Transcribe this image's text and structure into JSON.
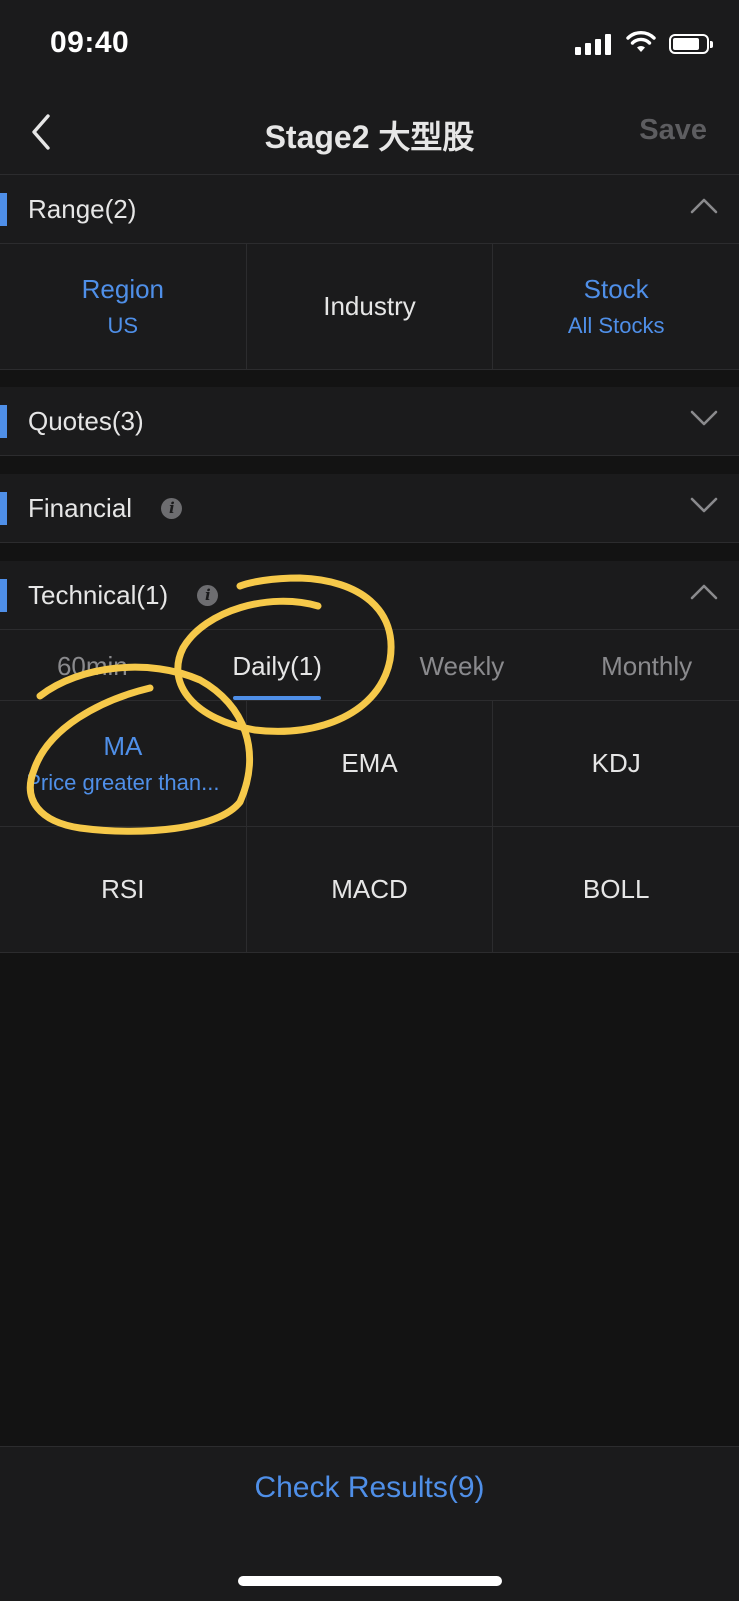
{
  "status_bar": {
    "time": "09:40"
  },
  "nav": {
    "title": "Stage2 大型股",
    "save_label": "Save"
  },
  "range": {
    "label": "Range(2)",
    "cells": [
      {
        "title": "Region",
        "value": "US"
      },
      {
        "title": "Industry",
        "value": ""
      },
      {
        "title": "Stock",
        "value": "All Stocks"
      }
    ]
  },
  "quotes": {
    "label": "Quotes(3)"
  },
  "financial": {
    "label": "Financial",
    "info_icon": "i"
  },
  "technical": {
    "label": "Technical(1)",
    "info_icon": "i",
    "tabs": [
      "60min",
      "Daily(1)",
      "Weekly",
      "Monthly"
    ],
    "active_tab": "Daily(1)",
    "indicators": [
      {
        "title": "MA",
        "value": "Price greater than..."
      },
      {
        "title": "EMA",
        "value": ""
      },
      {
        "title": "KDJ",
        "value": ""
      },
      {
        "title": "RSI",
        "value": ""
      },
      {
        "title": "MACD",
        "value": ""
      },
      {
        "title": "BOLL",
        "value": ""
      }
    ]
  },
  "footer": {
    "check_results": "Check Results(9)"
  },
  "colors": {
    "accent": "#4f8fe8",
    "annotation": "#f6c94a",
    "background": "#131313",
    "panel": "#1b1b1c"
  },
  "icons": [
    "back-chevron-icon",
    "chevron-up-icon",
    "chevron-down-icon",
    "info-icon",
    "signal-icon",
    "wifi-icon",
    "battery-icon"
  ]
}
